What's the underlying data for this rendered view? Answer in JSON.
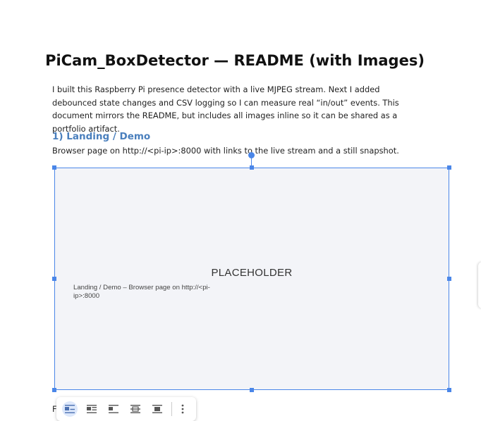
{
  "document": {
    "title": "PiCam_BoxDetector — README (with Images)",
    "intro": "I built this Raspberry Pi presence detector with a live MJPEG stream. Next I added debounced state changes and CSV logging so I can measure real “in/out” events. This document mirrors the README, but includes all images inline so it can be shared as a portfolio artifact.",
    "section1": {
      "heading": "1) Landing / Demo",
      "caption": "Browser page on http://<pi-ip>:8000 with links to the live stream and a still snapshot."
    },
    "image": {
      "placeholder_text": "PLACEHOLDER",
      "caption": "Landing / Demo – Browser page on http://<pi-ip>:8000"
    },
    "next_line_stub": "F"
  },
  "image_toolbar": {
    "buttons": [
      {
        "name": "inline-icon",
        "active": true
      },
      {
        "name": "wrap-text-icon",
        "active": false
      },
      {
        "name": "break-text-icon",
        "active": false
      },
      {
        "name": "behind-text-icon",
        "active": false
      },
      {
        "name": "in-front-of-text-icon",
        "active": false
      }
    ],
    "more": "more-options-icon"
  },
  "colors": {
    "selection": "#4a86e8",
    "heading": "#4a7fbd",
    "image_bg": "#f3f4f8",
    "active_button": "#dde8fb"
  }
}
